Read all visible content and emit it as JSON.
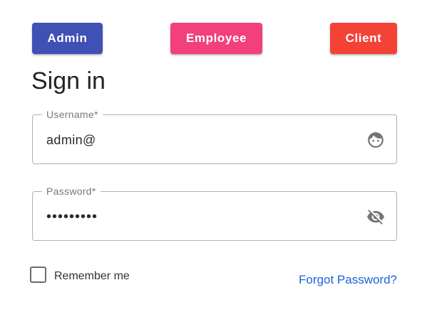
{
  "roles": {
    "admin": {
      "label": "Admin",
      "color": "#3f51b5"
    },
    "employee": {
      "label": "Employee",
      "color": "#f2407b"
    },
    "client": {
      "label": "Client",
      "color": "#f44336"
    }
  },
  "title": "Sign in",
  "username": {
    "label": "Username*",
    "value": "admin@",
    "icon": "face-icon"
  },
  "password": {
    "label": "Password*",
    "value": "•••••••••",
    "icon": "visibility-off-icon"
  },
  "remember": {
    "label": "Remember me",
    "checked": false
  },
  "forgot": {
    "label": "Forgot Password?",
    "color": "#1a63d6"
  }
}
